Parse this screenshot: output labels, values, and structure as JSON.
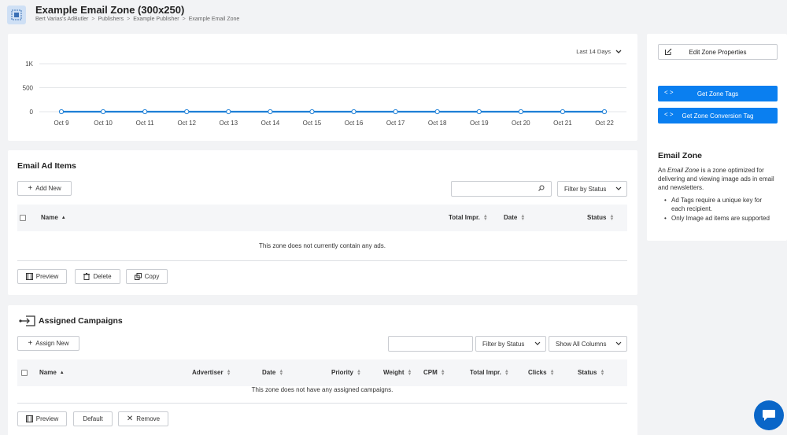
{
  "header": {
    "title": "Example Email Zone (300x250)",
    "breadcrumb": [
      "Bert Varias's AdButler",
      "Publishers",
      "Example Publisher",
      "Example Email Zone"
    ],
    "breadcrumb_sep": ">"
  },
  "chart": {
    "date_range": "Last 14 Days",
    "chart_data": {
      "type": "line",
      "categories": [
        "Oct 9",
        "Oct 10",
        "Oct 11",
        "Oct 12",
        "Oct 13",
        "Oct 14",
        "Oct 15",
        "Oct 16",
        "Oct 17",
        "Oct 18",
        "Oct 19",
        "Oct 20",
        "Oct 21",
        "Oct 22"
      ],
      "series": [
        {
          "values": [
            0,
            0,
            0,
            0,
            0,
            0,
            0,
            0,
            0,
            0,
            0,
            0,
            0,
            0
          ]
        }
      ],
      "ylim": [
        0,
        1000
      ],
      "yticks": [
        "0",
        "500",
        "1K"
      ],
      "grid": true,
      "colors": {
        "line": "#1e7fd6"
      }
    }
  },
  "ads": {
    "title": "Email Ad Items",
    "add_new": "Add New",
    "filter": "Filter by Status",
    "columns": {
      "name": "Name",
      "total_impr": "Total Impr.",
      "date": "Date",
      "status": "Status"
    },
    "empty": "This zone does not currently contain any ads.",
    "actions": {
      "preview": "Preview",
      "delete": "Delete",
      "copy": "Copy"
    }
  },
  "campaigns": {
    "title": "Assigned Campaigns",
    "assign_new": "Assign New",
    "filter": "Filter by Status",
    "columns_select": "Show All Columns",
    "columns": {
      "name": "Name",
      "advertiser": "Advertiser",
      "date": "Date",
      "priority": "Priority",
      "weight": "Weight",
      "cpm": "CPM",
      "total_impr": "Total Impr.",
      "clicks": "Clicks",
      "status": "Status"
    },
    "empty": "This zone does not have any assigned campaigns.",
    "actions": {
      "preview": "Preview",
      "default": "Default",
      "remove": "Remove"
    }
  },
  "side": {
    "edit_props": "Edit Zone Properties",
    "zone_tags": "Get Zone Tags",
    "conversion_tag": "Get Zone Conversion Tag",
    "code_glyph": "< >",
    "info_title": "Email Zone",
    "desc_prefix": "An ",
    "desc_em": "Email Zone",
    "desc_suffix": " is a zone optimized for delivering and viewing image ads in email and newsletters.",
    "bullets": [
      "Ad Tags require a unique key for each recipient.",
      "Only Image ad items are supported"
    ]
  },
  "colors": {
    "accent": "#0a7ff0",
    "chat": "#0a66c8"
  }
}
